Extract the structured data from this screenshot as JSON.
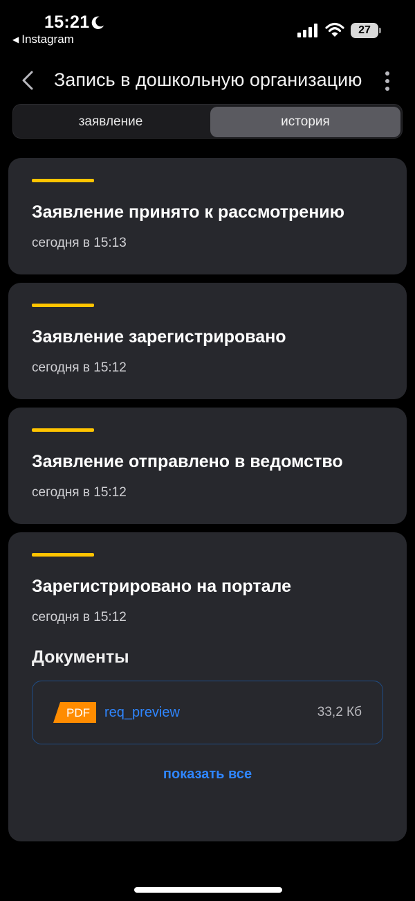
{
  "status_bar": {
    "time": "15:21",
    "back_app": "Instagram",
    "battery": "27"
  },
  "header": {
    "title": "Запись в дошкольную организацию"
  },
  "tabs": [
    {
      "label": "заявление",
      "active": false
    },
    {
      "label": "история",
      "active": true
    }
  ],
  "history": [
    {
      "title": "Заявление принято к рассмотрению",
      "time": "сегодня в 15:13"
    },
    {
      "title": "Заявление зарегистрировано",
      "time": "сегодня в 15:12"
    },
    {
      "title": "Заявление отправлено в ведомство",
      "time": "сегодня в 15:12"
    },
    {
      "title": "Зарегистрировано на портале",
      "time": "сегодня в 15:12"
    }
  ],
  "documents": {
    "heading": "Документы",
    "items": [
      {
        "type_label": "PDF",
        "name": "req_preview",
        "size": "33,2 Кб"
      }
    ],
    "show_all": "показать все"
  },
  "colors": {
    "background": "#000000",
    "card": "#27282d",
    "accent": "#ffc400",
    "link": "#2f86ff",
    "pdf": "#ff8c00"
  }
}
